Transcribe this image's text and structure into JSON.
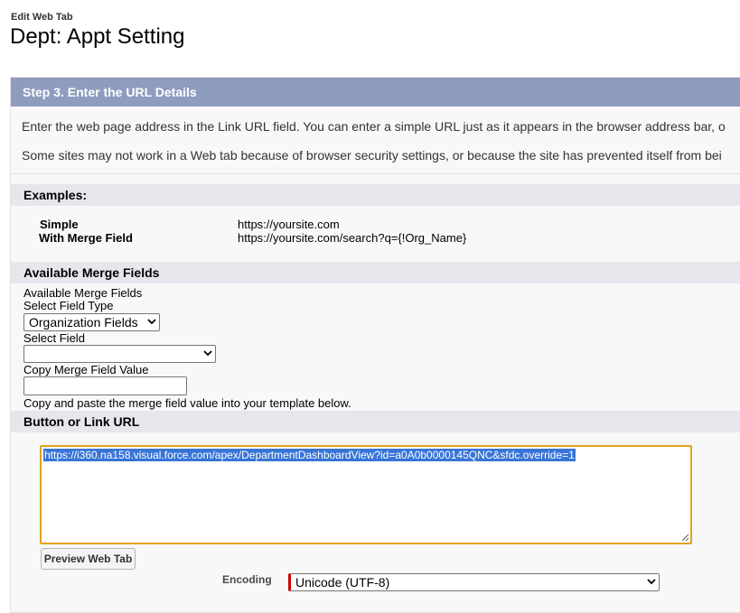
{
  "header": {
    "breadcrumb": "Edit Web Tab",
    "title": "Dept: Appt Setting"
  },
  "step": {
    "title": "Step 3. Enter the URL Details",
    "intro_1": "Enter the web page address in the Link URL field. You can enter a simple URL just as it appears in the browser address bar, o",
    "intro_2": "Some sites may not work in a Web tab because of browser security settings, or because the site has prevented itself from bei"
  },
  "examples": {
    "heading": "Examples:",
    "simple_label": "Simple",
    "simple_value": "https://yoursite.com",
    "merge_label": "With Merge Field",
    "merge_value": "https://yoursite.com/search?q={!Org_Name}"
  },
  "merge_fields": {
    "heading": "Available Merge Fields",
    "caption": "Available Merge Fields",
    "field_type_label": "Select Field Type",
    "field_type_value": "Organization Fields",
    "field_label": "Select Field",
    "field_value": "",
    "copy_label": "Copy Merge Field Value",
    "copy_value": "",
    "help_text": "Copy and paste the merge field value into your template below."
  },
  "url_section": {
    "heading": "Button or Link URL",
    "url_value": "https://i360.na158.visual.force.com/apex/DepartmentDashboardView?id=a0A0b0000145QNC&sfdc.override=1",
    "preview_button": "Preview Web Tab",
    "encoding_label": "Encoding",
    "encoding_value": "Unicode (UTF-8)"
  },
  "colors": {
    "step_header": "#8e9dbe",
    "section_bar": "#e5e7ec",
    "focus_border": "#e3a21a",
    "selection": "#3875d7",
    "required_marker": "#cc0000"
  }
}
